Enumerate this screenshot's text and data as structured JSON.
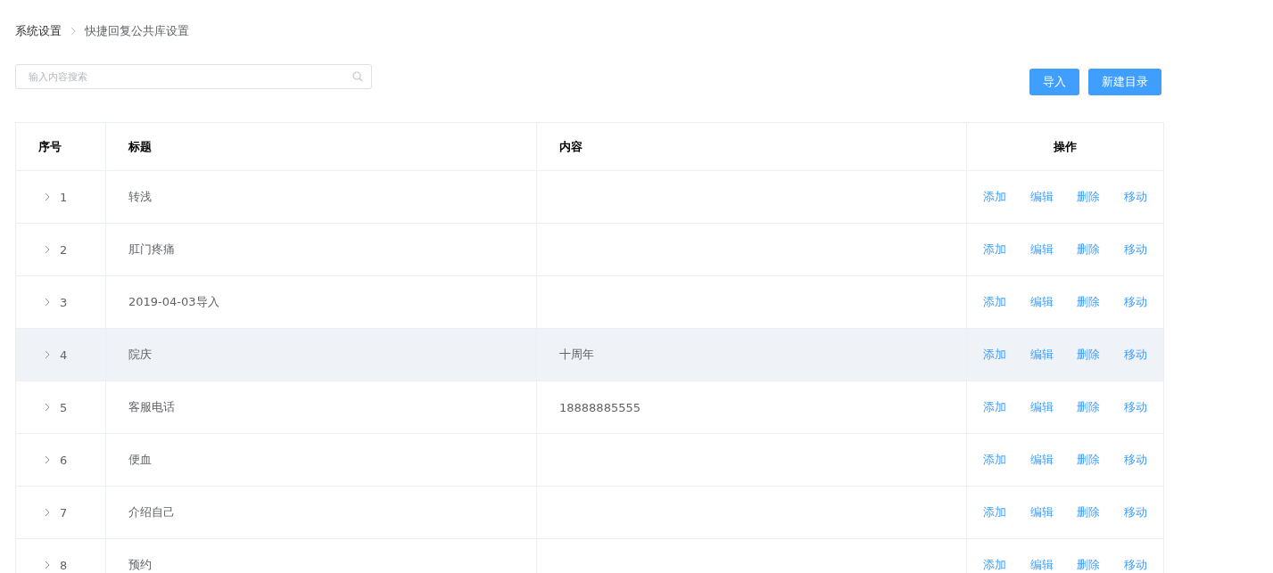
{
  "breadcrumb": [
    "系统设置",
    "快捷回复公共库设置"
  ],
  "search": {
    "placeholder": "输入内容搜索"
  },
  "buttons": [
    "导入",
    "新建目录"
  ],
  "table": {
    "columns": [
      "序号",
      "标题",
      "内容",
      "操作"
    ],
    "rows": [
      {
        "index": "1",
        "title": "转浅",
        "content": "",
        "expanded": false,
        "selected": false,
        "actions": [
          "添加",
          "编辑",
          "删除",
          "移动"
        ]
      },
      {
        "index": "2",
        "title": "肛门疼痛",
        "content": "",
        "expanded": false,
        "selected": false,
        "actions": [
          "添加",
          "编辑",
          "删除",
          "移动"
        ]
      },
      {
        "index": "3",
        "title": "2019-04-03导入",
        "content": "",
        "expanded": false,
        "selected": false,
        "actions": [
          "添加",
          "编辑",
          "删除",
          "移动"
        ]
      },
      {
        "index": "4",
        "title": "院庆",
        "content": "十周年",
        "expanded": false,
        "selected": true,
        "actions": [
          "添加",
          "编辑",
          "删除",
          "移动"
        ]
      },
      {
        "index": "5",
        "title": "客服电话",
        "content": "18888885555",
        "expanded": false,
        "selected": false,
        "actions": [
          "添加",
          "编辑",
          "删除",
          "移动"
        ]
      },
      {
        "index": "6",
        "title": "便血",
        "content": "",
        "expanded": false,
        "selected": false,
        "actions": [
          "添加",
          "编辑",
          "删除",
          "移动"
        ]
      },
      {
        "index": "7",
        "title": "介绍自己",
        "content": "",
        "expanded": false,
        "selected": false,
        "actions": [
          "添加",
          "编辑",
          "删除",
          "移动"
        ]
      },
      {
        "index": "8",
        "title": "预约",
        "content": "",
        "expanded": false,
        "selected": false,
        "actions": [
          "添加",
          "编辑",
          "删除",
          "移动"
        ]
      }
    ]
  }
}
